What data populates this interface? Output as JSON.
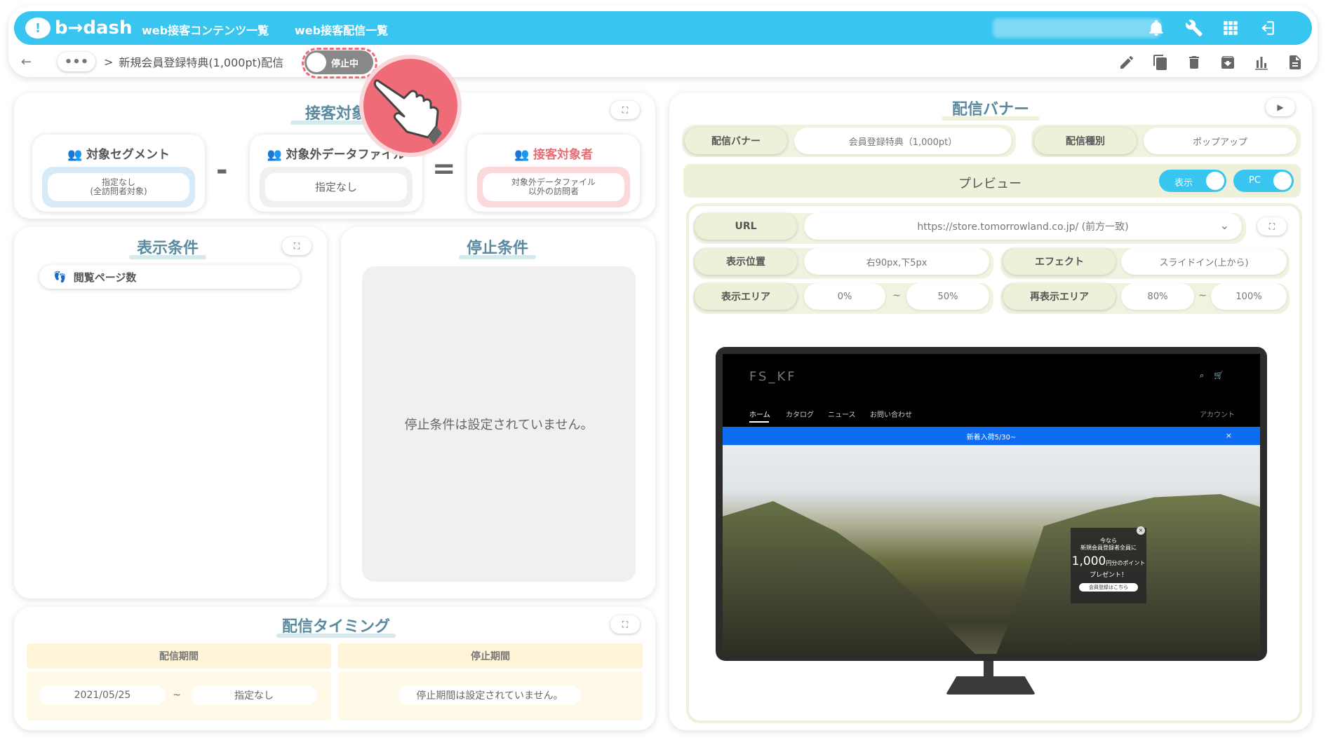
{
  "header": {
    "logo": "b→dash",
    "nav": [
      "web接客コンテンツ一覧",
      "web接客配信一覧"
    ],
    "icons": [
      "bell-icon",
      "wrench-icon",
      "grid-icon",
      "logout-icon"
    ]
  },
  "breadcrumb": {
    "ellipsis": "•••",
    "separator": ">",
    "current": "新規会員登録特典(1,000pt)配信",
    "status": "停止中"
  },
  "target_card": {
    "title": "接客対象",
    "segment": {
      "label": "対象セグメント",
      "value_line1": "指定なし",
      "value_line2": "(全訪問者対象)"
    },
    "minus": "-",
    "excluded": {
      "label": "対象外データファイル",
      "value": "指定なし"
    },
    "equals": "=",
    "result": {
      "label": "接客対象者",
      "value_line1": "対象外データファイル",
      "value_line2": "以外の訪問者"
    }
  },
  "display_conditions": {
    "title": "表示条件",
    "item": "閲覧ページ数"
  },
  "stop_conditions": {
    "title": "停止条件",
    "empty": "停止条件は設定されていません。"
  },
  "timing": {
    "title": "配信タイミング",
    "period_header": "配信期間",
    "stop_header": "停止期間",
    "start": "2021/05/25",
    "tilde": "~",
    "end": "指定なし",
    "stop_value": "停止期間は設定されていません。"
  },
  "banner_panel": {
    "title": "配信バナー",
    "banner_label": "配信バナー",
    "banner_value": "会員登録特典（1,000pt）",
    "type_label": "配信種別",
    "type_value": "ポップアップ",
    "preview_label": "プレビュー",
    "show_toggle": "表示",
    "device_toggle": "PC",
    "url_label": "URL",
    "url_value": "https://store.tomorrowland.co.jp/ (前方一致)",
    "position_label": "表示位置",
    "position_value": "右90px,下5px",
    "effect_label": "エフェクト",
    "effect_value": "スライドイン(上から)",
    "area_label": "表示エリア",
    "area_from": "0%",
    "area_to": "50%",
    "redisplay_label": "再表示エリア",
    "redisplay_from": "80%",
    "redisplay_to": "100%",
    "tilde": "~"
  },
  "site_preview": {
    "logo": "FS_KF",
    "menu": [
      "ホーム",
      "カタログ",
      "ニュース",
      "お問い合わせ"
    ],
    "account": "アカウント",
    "notice": "新着入荷5/30~",
    "notice_close": "×",
    "popup": {
      "line1": "今なら",
      "line2": "新規会員登録者全員に",
      "amount": "1,000",
      "unit": "円分の",
      "unit2": "ポイント",
      "present": "プレゼント！",
      "button": "会員登録はこちら",
      "close": "×"
    }
  },
  "colors": {
    "accent": "#38c5f0",
    "status_red": "#ef6b77"
  }
}
